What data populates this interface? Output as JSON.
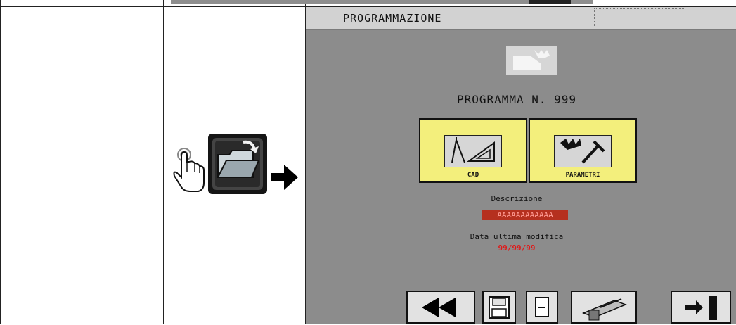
{
  "panel": {
    "header_title": "PROGRAMMAZIONE",
    "program_title": "PROGRAMMA N. 999",
    "cards": [
      {
        "label": "CAD",
        "icon": "cad-compass-icon"
      },
      {
        "label": "PARAMETRI",
        "icon": "parameters-tools-icon"
      }
    ],
    "description_label": "Descrizione",
    "description_value": "AAAAAAAAAAAA",
    "date_label": "Data ultima modifica",
    "date_value": "99/99/99",
    "bottom_buttons": [
      {
        "icon": "rewind-icon"
      },
      {
        "icon": "save-icon"
      },
      {
        "icon": "document-icon"
      },
      {
        "icon": "machine-icon"
      },
      {
        "icon": "exit-door-icon"
      }
    ]
  },
  "left_instruction": {
    "icons": [
      "hand-pointer-icon",
      "open-folder-icon",
      "arrow-right-icon"
    ]
  },
  "colors": {
    "panel_bg": "#8c8c8c",
    "header_bg": "#d2d2d2",
    "card_bg": "#f3ef7c",
    "accent_red": "#e01818"
  }
}
